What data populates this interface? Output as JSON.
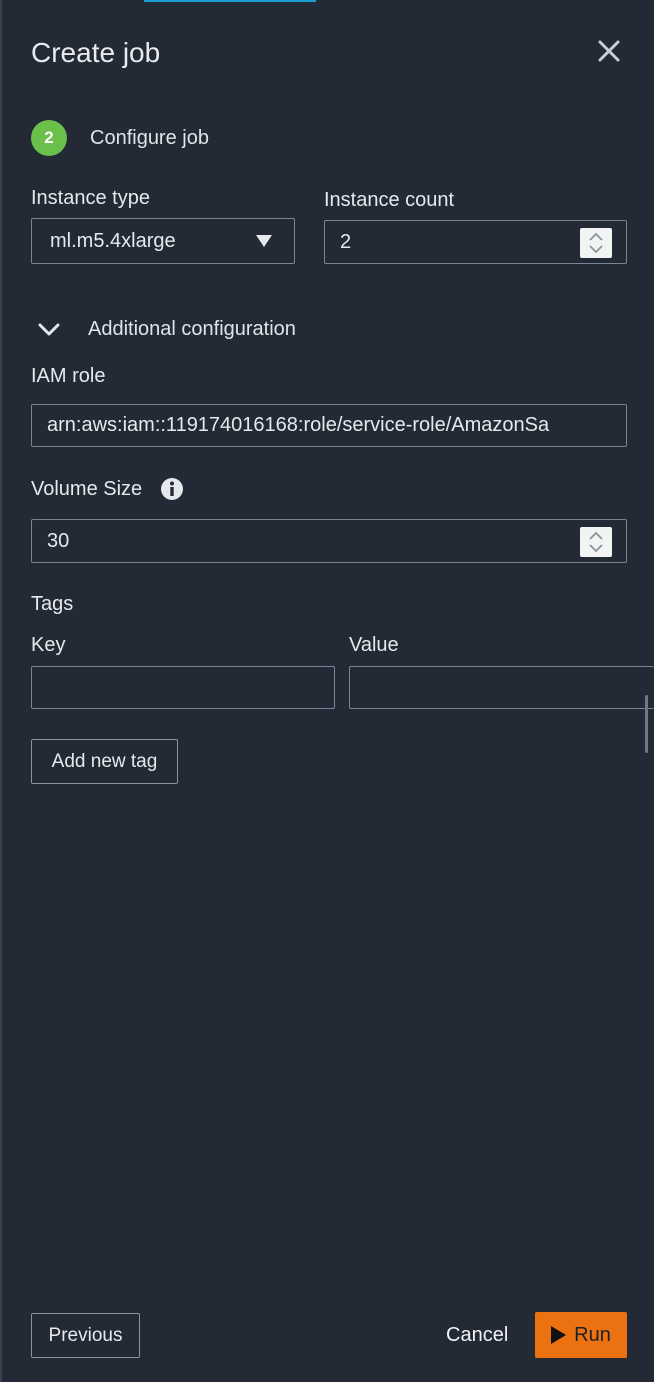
{
  "header": {
    "title": "Create job"
  },
  "step": {
    "number": "2",
    "label": "Configure job"
  },
  "instance_type": {
    "label": "Instance type",
    "value": "ml.m5.4xlarge"
  },
  "instance_count": {
    "label": "Instance count",
    "value": "2"
  },
  "additional_configuration": {
    "label": "Additional configuration",
    "expanded": true
  },
  "iam_role": {
    "label": "IAM role",
    "value": "arn:aws:iam::119174016168:role/service-role/AmazonSa"
  },
  "volume_size": {
    "label": "Volume Size",
    "value": "30"
  },
  "tags": {
    "label": "Tags",
    "key_label": "Key",
    "value_label": "Value",
    "key_value": "",
    "value_value": "",
    "add_button": "Add new tag"
  },
  "footer": {
    "previous": "Previous",
    "cancel": "Cancel",
    "run": "Run"
  },
  "colors": {
    "background": "#232a35",
    "step_badge": "#6bc04b",
    "run_button": "#ec7211",
    "accent": "#1a9ed0"
  }
}
